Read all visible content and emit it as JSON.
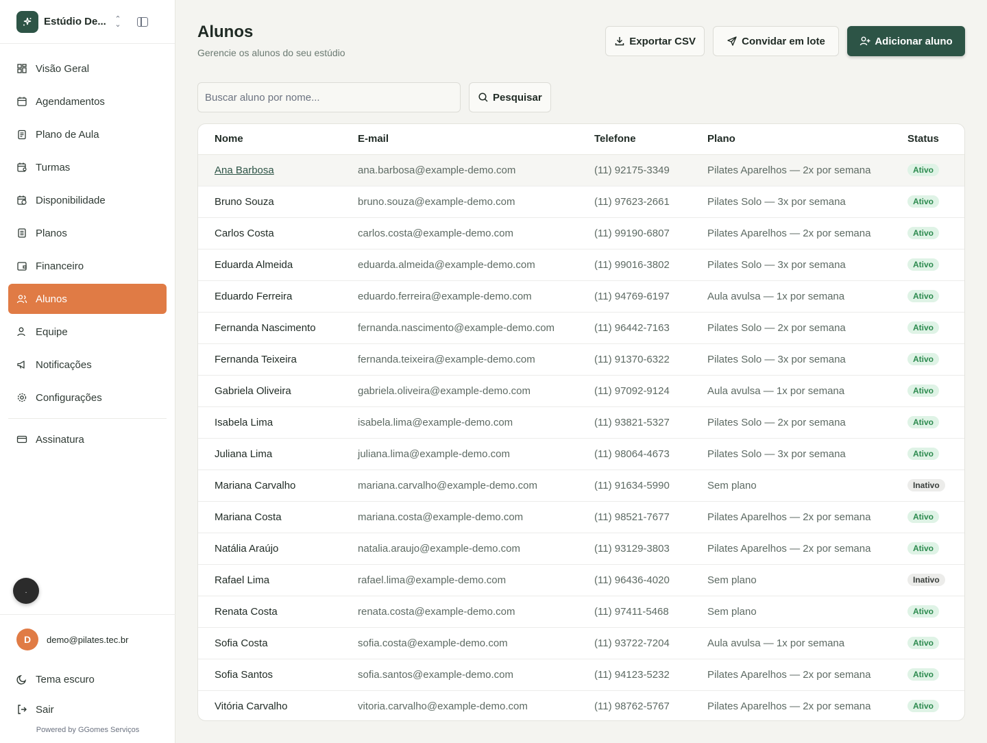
{
  "brand": {
    "name": "Estúdio De..."
  },
  "nav": {
    "items": [
      {
        "label": "Visão Geral",
        "icon": "grid-icon"
      },
      {
        "label": "Agendamentos",
        "icon": "calendar-icon"
      },
      {
        "label": "Plano de Aula",
        "icon": "clipboard-icon"
      },
      {
        "label": "Turmas",
        "icon": "calendar-users-icon"
      },
      {
        "label": "Disponibilidade",
        "icon": "calendar-clock-icon"
      },
      {
        "label": "Planos",
        "icon": "list-icon"
      },
      {
        "label": "Financeiro",
        "icon": "wallet-icon"
      },
      {
        "label": "Alunos",
        "icon": "users-icon"
      },
      {
        "label": "Equipe",
        "icon": "user-icon"
      },
      {
        "label": "Notificações",
        "icon": "megaphone-icon"
      },
      {
        "label": "Configurações",
        "icon": "gear-icon"
      }
    ],
    "subscription": "Assinatura",
    "active": "Alunos"
  },
  "footer": {
    "avatar_letter": "D",
    "email": "demo@pilates.tec.br",
    "dark_mode": "Tema escuro",
    "logout": "Sair",
    "powered": "Powered by GGomes Serviços",
    "dot": "."
  },
  "header": {
    "title": "Alunos",
    "subtitle": "Gerencie os alunos do seu estúdio",
    "export_label": "Exportar CSV",
    "invite_label": "Convidar em lote",
    "add_label": "Adicionar aluno"
  },
  "search": {
    "placeholder": "Buscar aluno por nome...",
    "button_label": "Pesquisar"
  },
  "table": {
    "columns": [
      "Nome",
      "E-mail",
      "Telefone",
      "Plano",
      "Status"
    ],
    "rows": [
      [
        "Ana Barbosa",
        "ana.barbosa@example-demo.com",
        "(11) 92175-3349",
        "Pilates Aparelhos — 2x por semana",
        "Ativo"
      ],
      [
        "Bruno Souza",
        "bruno.souza@example-demo.com",
        "(11) 97623-2661",
        "Pilates Solo — 3x por semana",
        "Ativo"
      ],
      [
        "Carlos Costa",
        "carlos.costa@example-demo.com",
        "(11) 99190-6807",
        "Pilates Aparelhos — 2x por semana",
        "Ativo"
      ],
      [
        "Eduarda Almeida",
        "eduarda.almeida@example-demo.com",
        "(11) 99016-3802",
        "Pilates Solo — 3x por semana",
        "Ativo"
      ],
      [
        "Eduardo Ferreira",
        "eduardo.ferreira@example-demo.com",
        "(11) 94769-6197",
        "Aula avulsa — 1x por semana",
        "Ativo"
      ],
      [
        "Fernanda Nascimento",
        "fernanda.nascimento@example-demo.com",
        "(11) 96442-7163",
        "Pilates Solo — 2x por semana",
        "Ativo"
      ],
      [
        "Fernanda Teixeira",
        "fernanda.teixeira@example-demo.com",
        "(11) 91370-6322",
        "Pilates Solo — 3x por semana",
        "Ativo"
      ],
      [
        "Gabriela Oliveira",
        "gabriela.oliveira@example-demo.com",
        "(11) 97092-9124",
        "Aula avulsa — 1x por semana",
        "Ativo"
      ],
      [
        "Isabela Lima",
        "isabela.lima@example-demo.com",
        "(11) 93821-5327",
        "Pilates Solo — 2x por semana",
        "Ativo"
      ],
      [
        "Juliana Lima",
        "juliana.lima@example-demo.com",
        "(11) 98064-4673",
        "Pilates Solo — 3x por semana",
        "Ativo"
      ],
      [
        "Mariana Carvalho",
        "mariana.carvalho@example-demo.com",
        "(11) 91634-5990",
        "Sem plano",
        "Inativo"
      ],
      [
        "Mariana Costa",
        "mariana.costa@example-demo.com",
        "(11) 98521-7677",
        "Pilates Aparelhos — 2x por semana",
        "Ativo"
      ],
      [
        "Natália Araújo",
        "natalia.araujo@example-demo.com",
        "(11) 93129-3803",
        "Pilates Aparelhos — 2x por semana",
        "Ativo"
      ],
      [
        "Rafael Lima",
        "rafael.lima@example-demo.com",
        "(11) 96436-4020",
        "Sem plano",
        "Inativo"
      ],
      [
        "Renata Costa",
        "renata.costa@example-demo.com",
        "(11) 97411-5468",
        "Sem plano",
        "Ativo"
      ],
      [
        "Sofia Costa",
        "sofia.costa@example-demo.com",
        "(11) 93722-7204",
        "Aula avulsa — 1x por semana",
        "Ativo"
      ],
      [
        "Sofia Santos",
        "sofia.santos@example-demo.com",
        "(11) 94123-5232",
        "Pilates Aparelhos — 2x por semana",
        "Ativo"
      ],
      [
        "Vitória Carvalho",
        "vitoria.carvalho@example-demo.com",
        "(11) 98762-5767",
        "Pilates Aparelhos — 2x por semana",
        "Ativo"
      ]
    ]
  },
  "colors": {
    "primary": "#2d5446",
    "accent": "#e07b45",
    "active_badge": "#dff3e6",
    "inactive_badge": "#ececea"
  }
}
